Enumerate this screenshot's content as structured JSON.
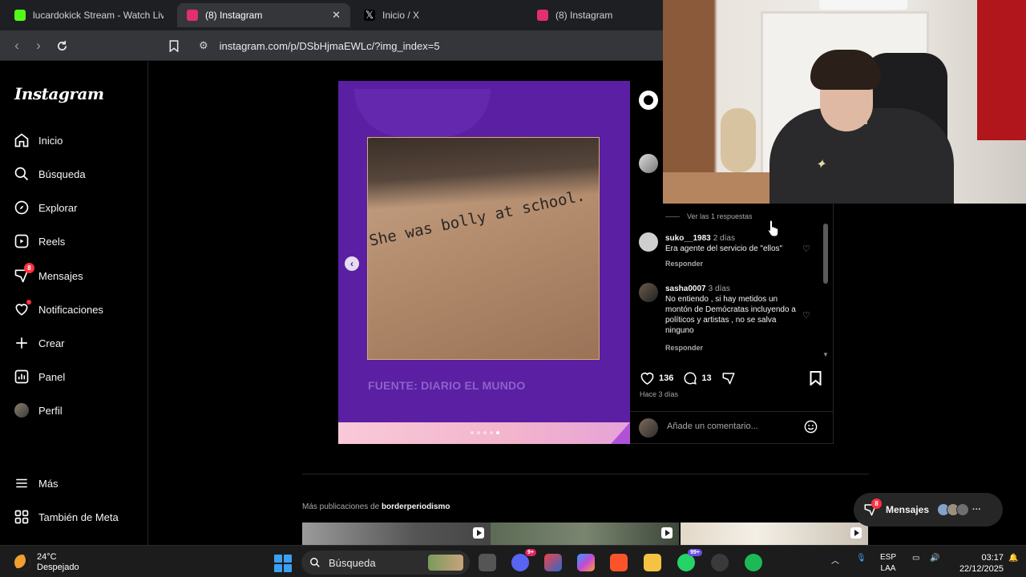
{
  "browser": {
    "tabs": [
      {
        "title": "lucardokick Stream - Watch Live o",
        "favicon_color": "#53fc18",
        "active": false
      },
      {
        "title": "(8) Instagram",
        "favicon_color": "#e1306c",
        "active": true,
        "close": "✕"
      },
      {
        "title": "Inicio / X",
        "favicon_color": "#000000",
        "active": false
      },
      {
        "title": "(8) Instagram",
        "favicon_color": "#e1306c",
        "active": false
      }
    ],
    "url": "instagram.com/p/DSbHjmaEWLc/?img_index=5"
  },
  "sidebar": {
    "logo": "Instagram",
    "items": [
      {
        "label": "Inicio",
        "icon": "home-icon"
      },
      {
        "label": "Búsqueda",
        "icon": "search-icon"
      },
      {
        "label": "Explorar",
        "icon": "compass-icon"
      },
      {
        "label": "Reels",
        "icon": "reels-icon"
      },
      {
        "label": "Mensajes",
        "icon": "messenger-icon",
        "badge": "8"
      },
      {
        "label": "Notificaciones",
        "icon": "heart-icon"
      },
      {
        "label": "Crear",
        "icon": "plus-icon"
      },
      {
        "label": "Panel",
        "icon": "chart-icon"
      },
      {
        "label": "Perfil",
        "icon": "avatar"
      },
      {
        "label": "Más",
        "icon": "menu-icon"
      },
      {
        "label": "También de Meta",
        "icon": "meta-icon"
      }
    ]
  },
  "post": {
    "image_text": "She was bolly at school.",
    "source_caption": "FUENTE: DIARIO EL MUNDO",
    "carousel_index": 5,
    "carousel_count": 5
  },
  "comments": {
    "view_replies": "Ver las 1 respuestas",
    "items": [
      {
        "user": "suko__1983",
        "time": "2 días",
        "text": "Era agente del servicio de \"ellos\"",
        "reply": "Responder"
      },
      {
        "user": "sasha0007",
        "time": "3 días",
        "text": "No entiendo , si hay metidos un montón de Demócratas incluyendo a políticos y artistas , no se salva ninguno",
        "reply": "Responder"
      }
    ],
    "likes": "136",
    "comment_count": "13",
    "posted_ago": "Hace 3 días",
    "add_comment_placeholder": "Añade un comentario..."
  },
  "more_posts": {
    "prefix": "Más publicaciones de",
    "account": "borderperiodismo"
  },
  "messages_pill": {
    "label": "Mensajes",
    "badge": "8"
  },
  "taskbar": {
    "temperature": "24°C",
    "condition": "Despejado",
    "search_label": "Búsqueda",
    "discord_badge": "9+",
    "whatsapp_badge": "99+",
    "lang_top": "ESP",
    "lang_bottom": "LAA",
    "time": "03:17",
    "date": "22/12/2025"
  },
  "colors": {
    "post_purple": "#5b1fa3",
    "badge_red": "#ff3040",
    "ig_bg": "#000000"
  }
}
